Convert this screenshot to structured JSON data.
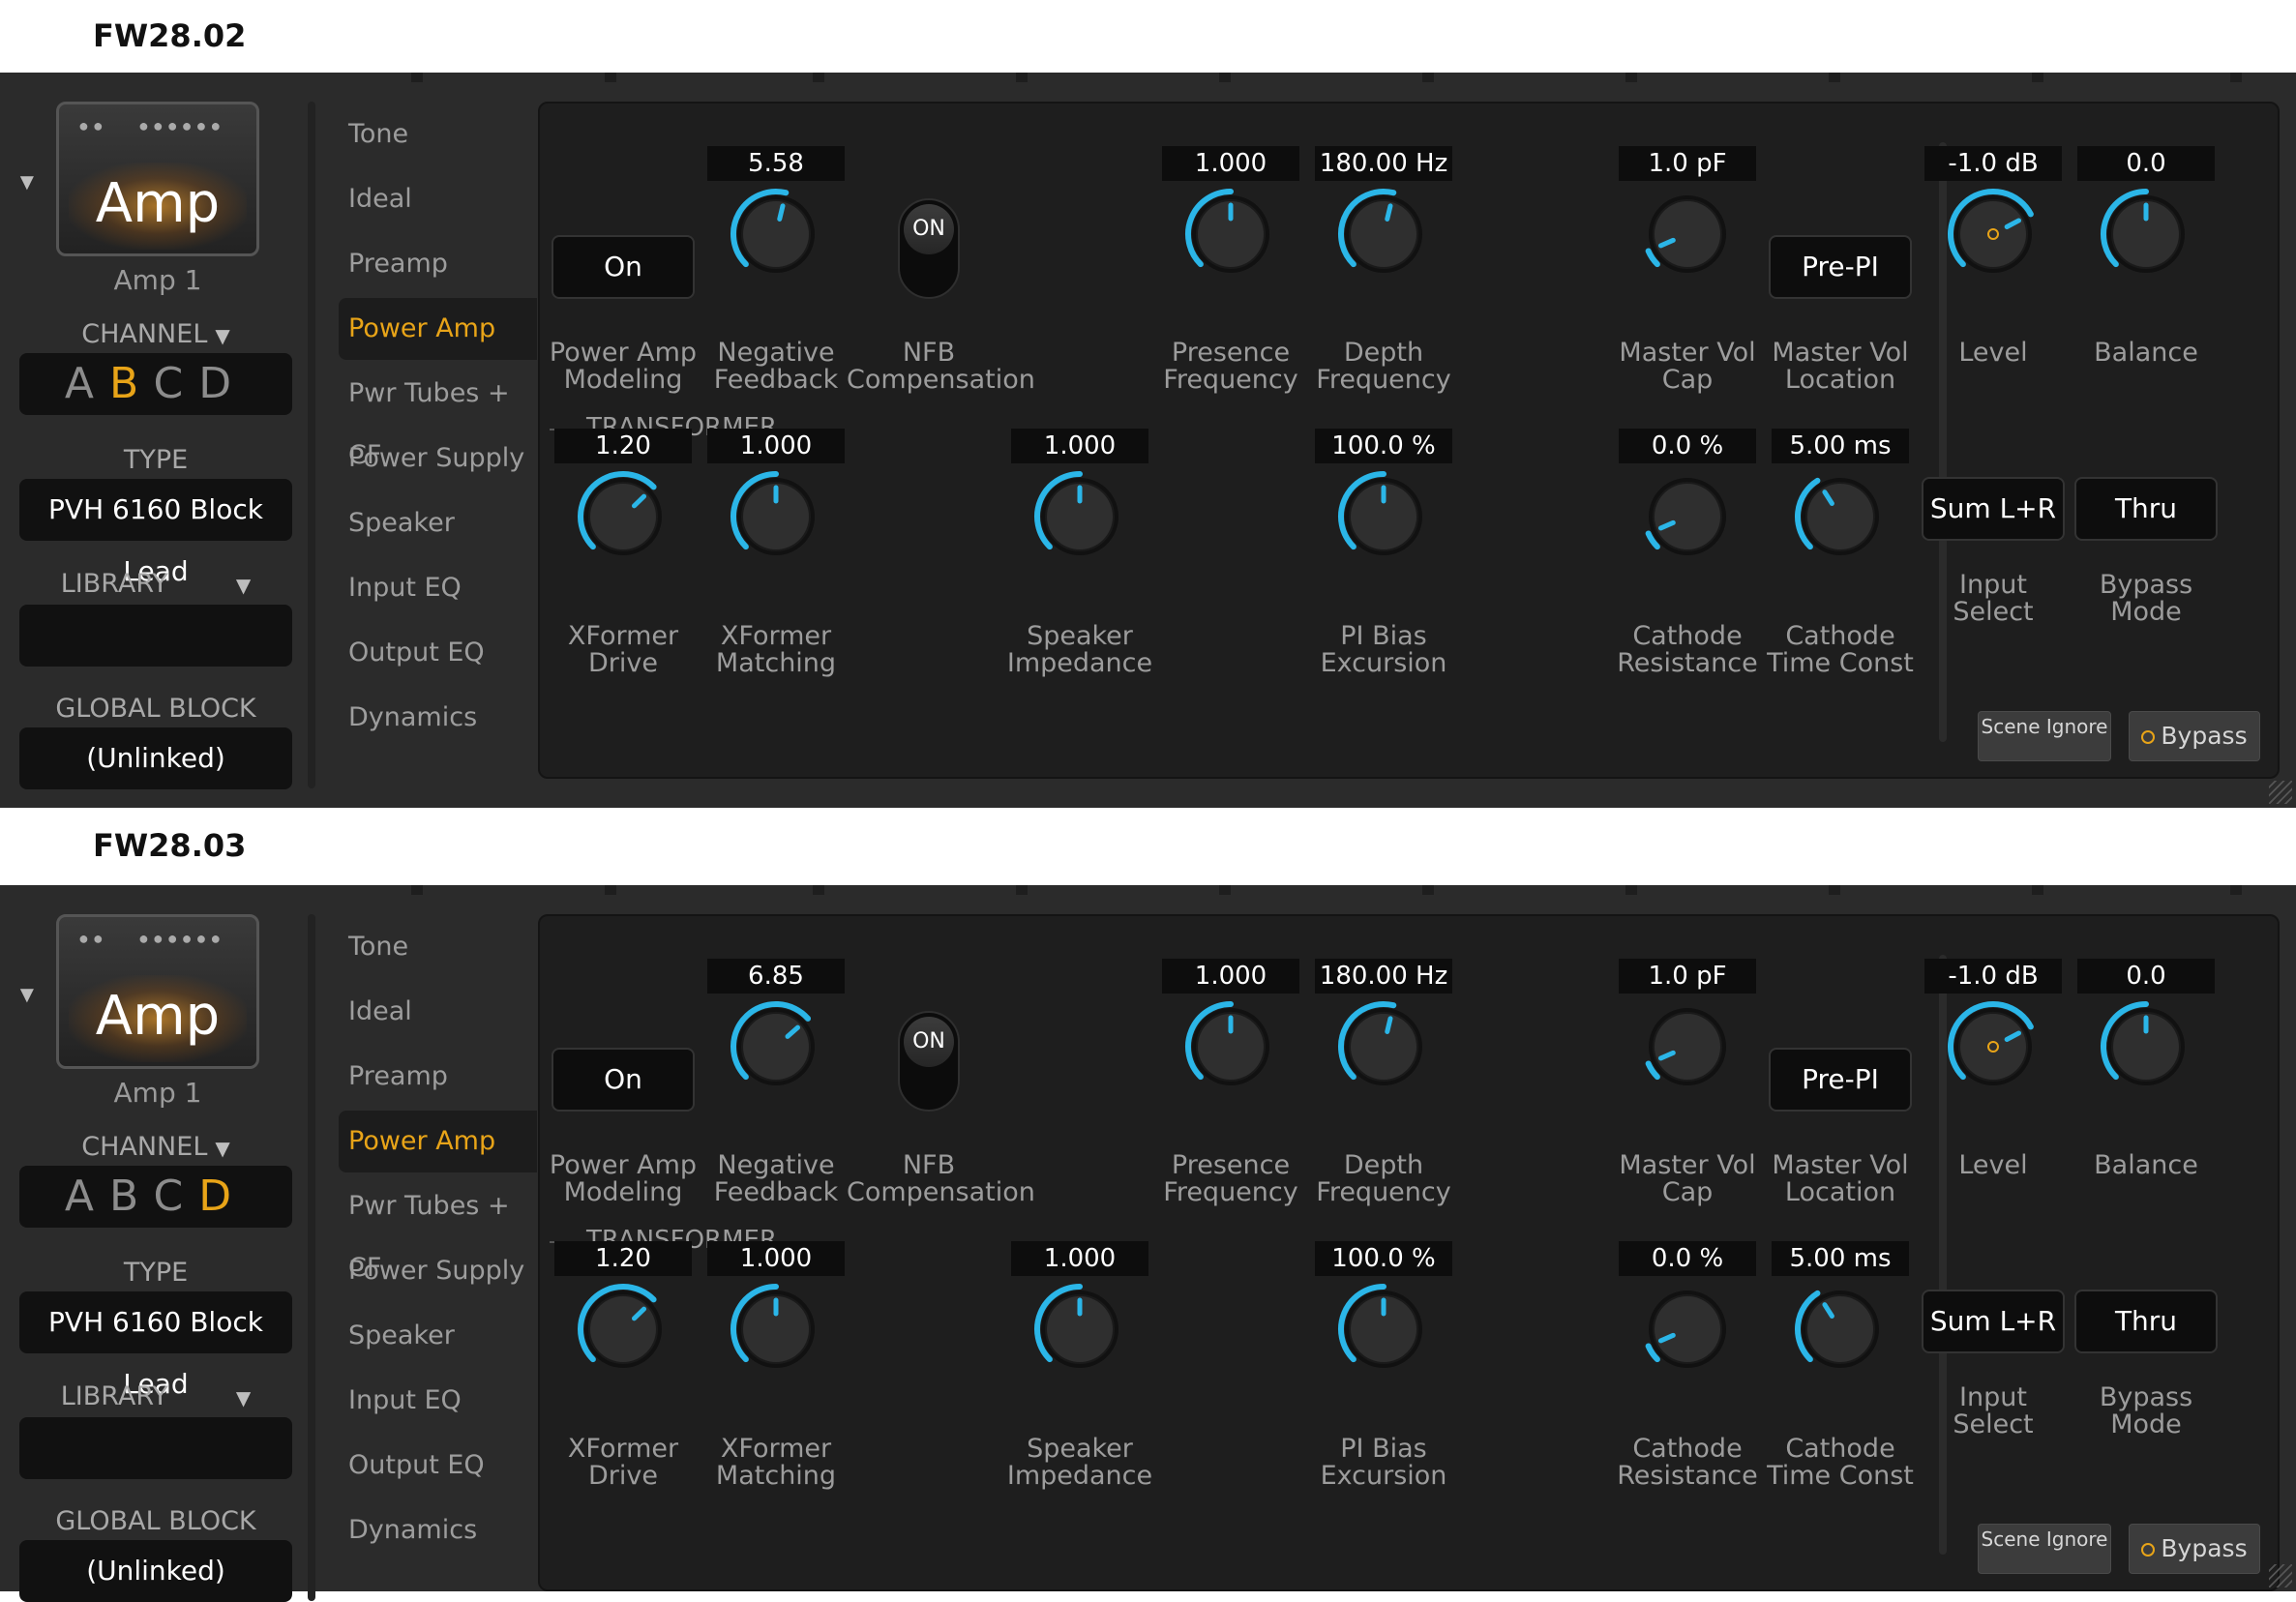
{
  "panels": [
    {
      "caption": "FW28.02",
      "amp": {
        "title": "Amp",
        "subtitle": "Amp 1"
      },
      "channel": {
        "label": "CHANNEL",
        "letters": [
          "A",
          "B",
          "C",
          "D"
        ],
        "active": "B"
      },
      "type": {
        "label": "TYPE",
        "value": "PVH 6160 Block Lead"
      },
      "library": {
        "label": "LIBRARY",
        "value": ""
      },
      "global_block": {
        "label": "GLOBAL BLOCK",
        "value": "(Unlinked)"
      },
      "menu": [
        "Tone",
        "Ideal",
        "Preamp",
        "Power Amp",
        "Pwr Tubes + CF",
        "Power Supply",
        "Speaker",
        "Input EQ",
        "Output EQ",
        "Dynamics"
      ],
      "menu_active": "Power Amp",
      "params": {
        "power_amp_modeling": {
          "label1": "Power Amp",
          "label2": "Modeling",
          "value": "On"
        },
        "negative_feedback": {
          "label1": "Negative",
          "label2": "Feedback",
          "value": "5.58",
          "level": 0.55
        },
        "nfb_compensation": {
          "label1": "NFB",
          "label2": "Compensation",
          "value": "ON"
        },
        "presence_frequency": {
          "label1": "Presence",
          "label2": "Frequency",
          "value": "1.000",
          "level": 0.5
        },
        "depth_frequency": {
          "label1": "Depth",
          "label2": "Frequency",
          "value": "180.00 Hz",
          "level": 0.55
        },
        "master_vol_cap": {
          "label1": "Master Vol",
          "label2": "Cap",
          "value": "1.0 pF",
          "level": 0.08
        },
        "master_vol_location": {
          "label1": "Master Vol",
          "label2": "Location",
          "value": "Pre-PI"
        },
        "level": {
          "label1": "Level",
          "label2": "",
          "value": "-1.0 dB",
          "level": 0.73
        },
        "balance": {
          "label1": "Balance",
          "label2": "",
          "value": "0.0",
          "level": 0.5
        },
        "transformer_label": "TRANSFORMER",
        "xformer_drive": {
          "label1": "XFormer",
          "label2": "Drive",
          "value": "1.20",
          "level": 0.67
        },
        "xformer_matching": {
          "label1": "XFormer",
          "label2": "Matching",
          "value": "1.000",
          "level": 0.5
        },
        "speaker_impedance": {
          "label1": "Speaker",
          "label2": "Impedance",
          "value": "1.000",
          "level": 0.5
        },
        "pi_bias_excursion": {
          "label1": "PI Bias",
          "label2": "Excursion",
          "value": "100.0 %",
          "level": 0.5
        },
        "cathode_resistance": {
          "label1": "Cathode",
          "label2": "Resistance",
          "value": "0.0 %",
          "level": 0.08
        },
        "cathode_time_const": {
          "label1": "Cathode",
          "label2": "Time Const",
          "value": "5.00 ms",
          "level": 0.38
        },
        "input_select": {
          "label1": "Input",
          "label2": "Select",
          "value": "Sum L+R"
        },
        "bypass_mode": {
          "label1": "Bypass",
          "label2": "Mode",
          "value": "Thru"
        },
        "scene_ignore": "Scene Ignore",
        "bypass": "Bypass"
      }
    },
    {
      "caption": "FW28.03",
      "amp": {
        "title": "Amp",
        "subtitle": "Amp 1"
      },
      "channel": {
        "label": "CHANNEL",
        "letters": [
          "A",
          "B",
          "C",
          "D"
        ],
        "active": "D"
      },
      "type": {
        "label": "TYPE",
        "value": "PVH 6160 Block Lead"
      },
      "library": {
        "label": "LIBRARY",
        "value": ""
      },
      "global_block": {
        "label": "GLOBAL BLOCK",
        "value": "(Unlinked)"
      },
      "menu": [
        "Tone",
        "Ideal",
        "Preamp",
        "Power Amp",
        "Pwr Tubes + CF",
        "Power Supply",
        "Speaker",
        "Input EQ",
        "Output EQ",
        "Dynamics"
      ],
      "menu_active": "Power Amp",
      "params": {
        "power_amp_modeling": {
          "label1": "Power Amp",
          "label2": "Modeling",
          "value": "On"
        },
        "negative_feedback": {
          "label1": "Negative",
          "label2": "Feedback",
          "value": "6.85",
          "level": 0.68
        },
        "nfb_compensation": {
          "label1": "NFB",
          "label2": "Compensation",
          "value": "ON"
        },
        "presence_frequency": {
          "label1": "Presence",
          "label2": "Frequency",
          "value": "1.000",
          "level": 0.5
        },
        "depth_frequency": {
          "label1": "Depth",
          "label2": "Frequency",
          "value": "180.00 Hz",
          "level": 0.55
        },
        "master_vol_cap": {
          "label1": "Master Vol",
          "label2": "Cap",
          "value": "1.0 pF",
          "level": 0.08
        },
        "master_vol_location": {
          "label1": "Master Vol",
          "label2": "Location",
          "value": "Pre-PI"
        },
        "level": {
          "label1": "Level",
          "label2": "",
          "value": "-1.0 dB",
          "level": 0.73
        },
        "balance": {
          "label1": "Balance",
          "label2": "",
          "value": "0.0",
          "level": 0.5
        },
        "transformer_label": "TRANSFORMER",
        "xformer_drive": {
          "label1": "XFormer",
          "label2": "Drive",
          "value": "1.20",
          "level": 0.67
        },
        "xformer_matching": {
          "label1": "XFormer",
          "label2": "Matching",
          "value": "1.000",
          "level": 0.5
        },
        "speaker_impedance": {
          "label1": "Speaker",
          "label2": "Impedance",
          "value": "1.000",
          "level": 0.5
        },
        "pi_bias_excursion": {
          "label1": "PI Bias",
          "label2": "Excursion",
          "value": "100.0 %",
          "level": 0.5
        },
        "cathode_resistance": {
          "label1": "Cathode",
          "label2": "Resistance",
          "value": "0.0 %",
          "level": 0.08
        },
        "cathode_time_const": {
          "label1": "Cathode",
          "label2": "Time Const",
          "value": "5.00 ms",
          "level": 0.38
        },
        "input_select": {
          "label1": "Input",
          "label2": "Select",
          "value": "Sum L+R"
        },
        "bypass_mode": {
          "label1": "Bypass",
          "label2": "Mode",
          "value": "Thru"
        },
        "scene_ignore": "Scene Ignore",
        "bypass": "Bypass"
      }
    }
  ],
  "colors": {
    "accent_amber": "#e8a418",
    "knob_arc_blue": "#2bb6e8",
    "panel_bg": "#2b2b2b",
    "main_bg": "#1e1e1e"
  }
}
